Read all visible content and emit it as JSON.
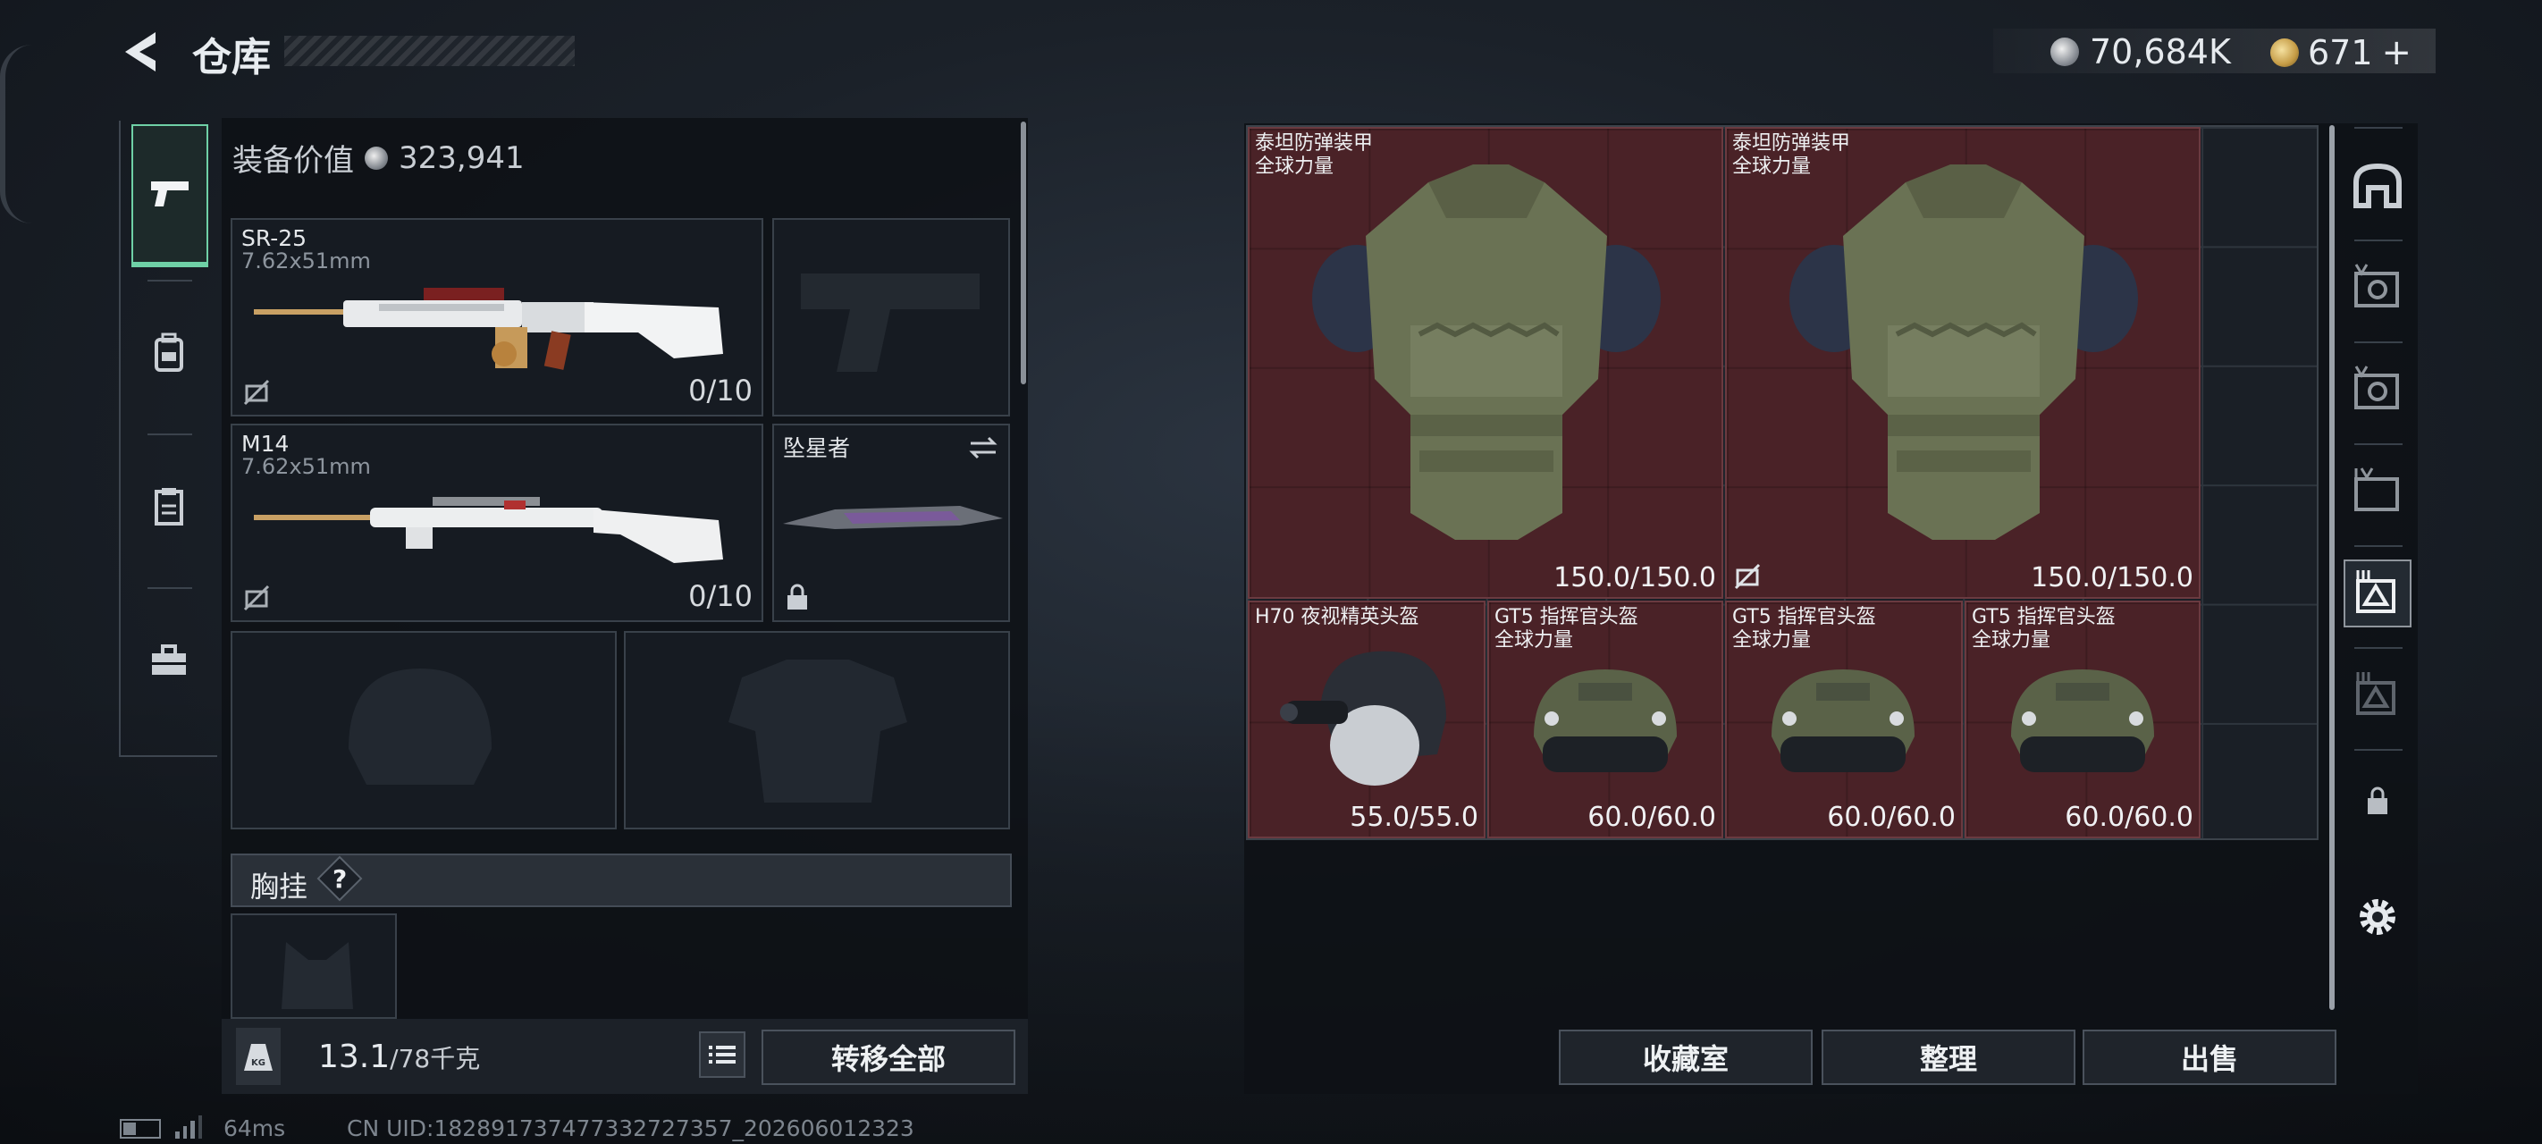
{
  "header": {
    "title": "仓库",
    "currency_silver": "70,684K",
    "currency_gold": "671",
    "add_symbol": "+"
  },
  "side_tabs": [
    "weapon-tab",
    "backpack-tab",
    "container-tab",
    "toolbox-tab"
  ],
  "loadout": {
    "value_label": "装备价值",
    "value": "323,941",
    "primary1": {
      "name": "SR-25",
      "caliber": "7.62x51mm",
      "ammo": "0/10"
    },
    "primary2": {
      "name": "M14",
      "caliber": "7.62x51mm",
      "ammo": "0/10"
    },
    "melee": {
      "name": "坠星者"
    },
    "chest_rig_label": "胸挂",
    "chest_rig_help": "?",
    "weight": "13.1",
    "weight_max": "/78千克",
    "transfer_all": "转移全部",
    "weight_icon_text": "KG"
  },
  "stash_items": [
    {
      "name": "泰坦防弹装甲",
      "sub": "全球力量",
      "durability": "150.0/150.0"
    },
    {
      "name": "泰坦防弹装甲",
      "sub": "全球力量",
      "durability": "150.0/150.0"
    },
    {
      "name": "H70 夜视精英头盔",
      "sub": "",
      "durability": "55.0/55.0"
    },
    {
      "name": "GT5 指挥官头盔",
      "sub": "全球力量",
      "durability": "60.0/60.0"
    },
    {
      "name": "GT5 指挥官头盔",
      "sub": "全球力量",
      "durability": "60.0/60.0"
    },
    {
      "name": "GT5 指挥官头盔",
      "sub": "全球力量",
      "durability": "60.0/60.0"
    }
  ],
  "actions": {
    "collection": "收藏室",
    "sort": "整理",
    "sell": "出售"
  },
  "status": {
    "ping": "64ms",
    "uid": "CN UID:182891737477332727357_202606012323"
  },
  "colors": {
    "accent": "#6fd0a6",
    "item_bg": "#4a2227"
  }
}
